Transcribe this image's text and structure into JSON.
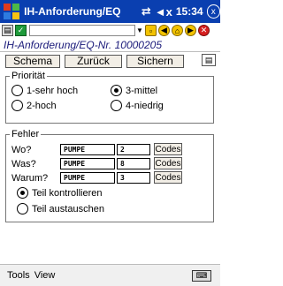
{
  "titlebar": {
    "title": "IH-Anforderung/EQ",
    "time": "15:34",
    "sync_glyph": "⇄",
    "volume_glyph": "◄x",
    "close_label": "x"
  },
  "toolbar": {
    "search_value": ""
  },
  "header": {
    "text": "IH-Anforderung/EQ-Nr. 10000205"
  },
  "nav": {
    "schema": "Schema",
    "zurueck": "Zurück",
    "sichern": "Sichern"
  },
  "prioritaet": {
    "title": "Priorität",
    "options": [
      {
        "label": "1-sehr hoch",
        "checked": false
      },
      {
        "label": "2-hoch",
        "checked": false
      },
      {
        "label": "3-mittel",
        "checked": true
      },
      {
        "label": "4-niedrig",
        "checked": false
      }
    ]
  },
  "fehler": {
    "title": "Fehler",
    "rows": [
      {
        "label": "Wo?",
        "value": "PUMPE",
        "code": "2",
        "button": "Codes"
      },
      {
        "label": "Was?",
        "value": "PUMPE",
        "code": "8",
        "button": "Codes"
      },
      {
        "label": "Warum?",
        "value": "PUMPE",
        "code": "3",
        "button": "Codes"
      }
    ],
    "actions": [
      {
        "label": "Teil kontrollieren",
        "checked": true
      },
      {
        "label": "Teil austauschen",
        "checked": false
      }
    ]
  },
  "bottom": {
    "tools": "Tools",
    "view": "View"
  }
}
